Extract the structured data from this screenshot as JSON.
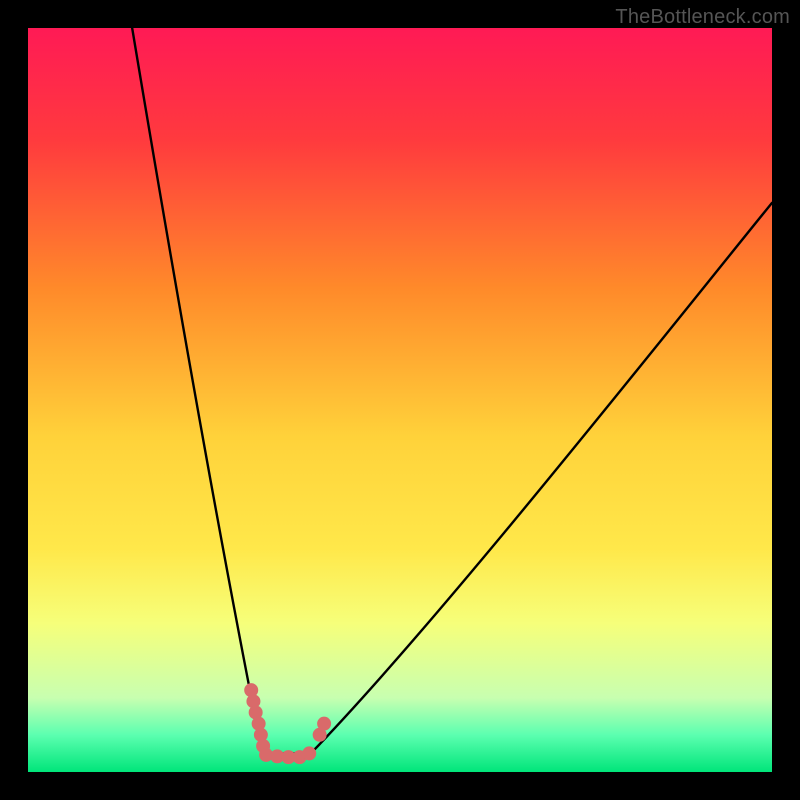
{
  "watermark": "TheBottleneck.com",
  "gradient": {
    "stops": [
      {
        "pct": 0,
        "color": "#ff1a55"
      },
      {
        "pct": 15,
        "color": "#ff3a3e"
      },
      {
        "pct": 35,
        "color": "#ff8a2a"
      },
      {
        "pct": 55,
        "color": "#ffd23a"
      },
      {
        "pct": 70,
        "color": "#ffe84a"
      },
      {
        "pct": 80,
        "color": "#f6ff7a"
      },
      {
        "pct": 90,
        "color": "#c8ffb0"
      },
      {
        "pct": 95,
        "color": "#5cffb0"
      },
      {
        "pct": 100,
        "color": "#00e57a"
      }
    ]
  },
  "curve": {
    "stroke": "#000000",
    "stroke_width": 2.4,
    "left_start": {
      "x": 0.14,
      "y": 0.0
    },
    "vertex_left": {
      "x": 0.315,
      "y": 0.975
    },
    "vertex_right": {
      "x": 0.38,
      "y": 0.975
    },
    "right_end": {
      "x": 1.0,
      "y": 0.235
    }
  },
  "markers": {
    "color": "#d96a6a",
    "radius": 7,
    "points": [
      {
        "x": 0.3,
        "y": 0.89
      },
      {
        "x": 0.303,
        "y": 0.905
      },
      {
        "x": 0.306,
        "y": 0.92
      },
      {
        "x": 0.31,
        "y": 0.935
      },
      {
        "x": 0.313,
        "y": 0.95
      },
      {
        "x": 0.316,
        "y": 0.965
      },
      {
        "x": 0.32,
        "y": 0.977
      },
      {
        "x": 0.335,
        "y": 0.979
      },
      {
        "x": 0.35,
        "y": 0.98
      },
      {
        "x": 0.365,
        "y": 0.98
      },
      {
        "x": 0.378,
        "y": 0.975
      },
      {
        "x": 0.392,
        "y": 0.95
      },
      {
        "x": 0.398,
        "y": 0.935
      }
    ]
  },
  "chart_data": {
    "type": "line",
    "title": "",
    "xlabel": "",
    "ylabel": "",
    "xlim": [
      0,
      1
    ],
    "ylim": [
      0,
      1
    ],
    "note": "x,y in normalized plot coordinates; y=0 is top. Curve traces a V-shaped bottleneck trough; markers highlight the optimal (green) region near the bottom.",
    "series": [
      {
        "name": "bottleneck-curve",
        "x": [
          0.14,
          0.18,
          0.22,
          0.26,
          0.3,
          0.315,
          0.33,
          0.35,
          0.38,
          0.42,
          0.5,
          0.6,
          0.72,
          0.86,
          1.0
        ],
        "y": [
          0.0,
          0.22,
          0.45,
          0.7,
          0.9,
          0.975,
          0.98,
          0.98,
          0.975,
          0.92,
          0.8,
          0.66,
          0.52,
          0.37,
          0.235
        ]
      },
      {
        "name": "optimal-markers",
        "x": [
          0.3,
          0.303,
          0.306,
          0.31,
          0.313,
          0.316,
          0.32,
          0.335,
          0.35,
          0.365,
          0.378,
          0.392,
          0.398
        ],
        "y": [
          0.89,
          0.905,
          0.92,
          0.935,
          0.95,
          0.965,
          0.977,
          0.979,
          0.98,
          0.98,
          0.975,
          0.95,
          0.935
        ]
      }
    ]
  }
}
